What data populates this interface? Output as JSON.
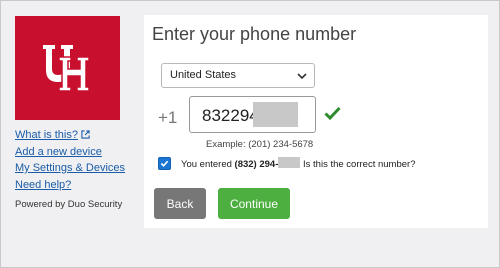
{
  "sidebar": {
    "links": [
      {
        "label": "What is this?",
        "external": true
      },
      {
        "label": "Add a new device"
      },
      {
        "label": "My Settings & Devices"
      },
      {
        "label": "Need help?"
      }
    ],
    "powered_by": "Powered by Duo Security"
  },
  "main": {
    "title": "Enter your phone number",
    "country_select": {
      "value": "United States"
    },
    "phone": {
      "prefix": "+1",
      "visible_value": "832294",
      "example": "Example: (201) 234-5678"
    },
    "confirm": {
      "checked": true,
      "text_before": "You entered ",
      "number_visible": "(832) 294-",
      "text_after": " Is this the correct number?"
    },
    "buttons": {
      "back": "Back",
      "continue": "Continue"
    }
  },
  "colors": {
    "brand_red": "#c8102e",
    "link_blue": "#1a5ca8",
    "continue_green": "#4caf3f",
    "back_gray": "#777777",
    "checkbox_blue": "#1976d2"
  }
}
